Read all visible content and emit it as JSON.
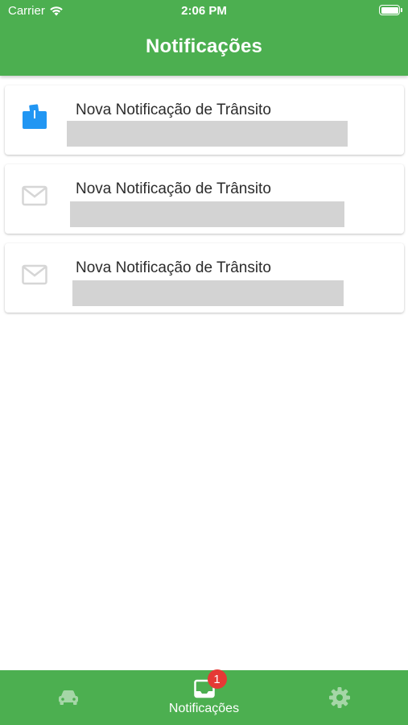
{
  "status_bar": {
    "carrier": "Carrier",
    "time": "2:06 PM"
  },
  "header": {
    "title": "Notificações"
  },
  "notifications": [
    {
      "title": "Nova Notificação de Trânsito",
      "icon": "mailbox-open-icon",
      "read": false
    },
    {
      "title": "Nova Notificação de Trânsito",
      "icon": "envelope-icon",
      "read": true
    },
    {
      "title": "Nova Notificação de Trânsito",
      "icon": "envelope-icon",
      "read": true
    }
  ],
  "tab_bar": {
    "tabs": [
      {
        "id": "vehicles",
        "icon": "car-icon",
        "label": "",
        "active": false
      },
      {
        "id": "notifications",
        "icon": "inbox-icon",
        "label": "Notificações",
        "badge": "1",
        "active": true
      },
      {
        "id": "settings",
        "icon": "gear-icon",
        "label": "",
        "active": false
      }
    ]
  },
  "colors": {
    "primary": "#4caf50",
    "unread_icon": "#2196f3",
    "read_icon": "#d6d6d6",
    "placeholder": "#d3d3d3",
    "badge": "#e53935",
    "inactive_tab_icon": "#a5d6a7"
  }
}
